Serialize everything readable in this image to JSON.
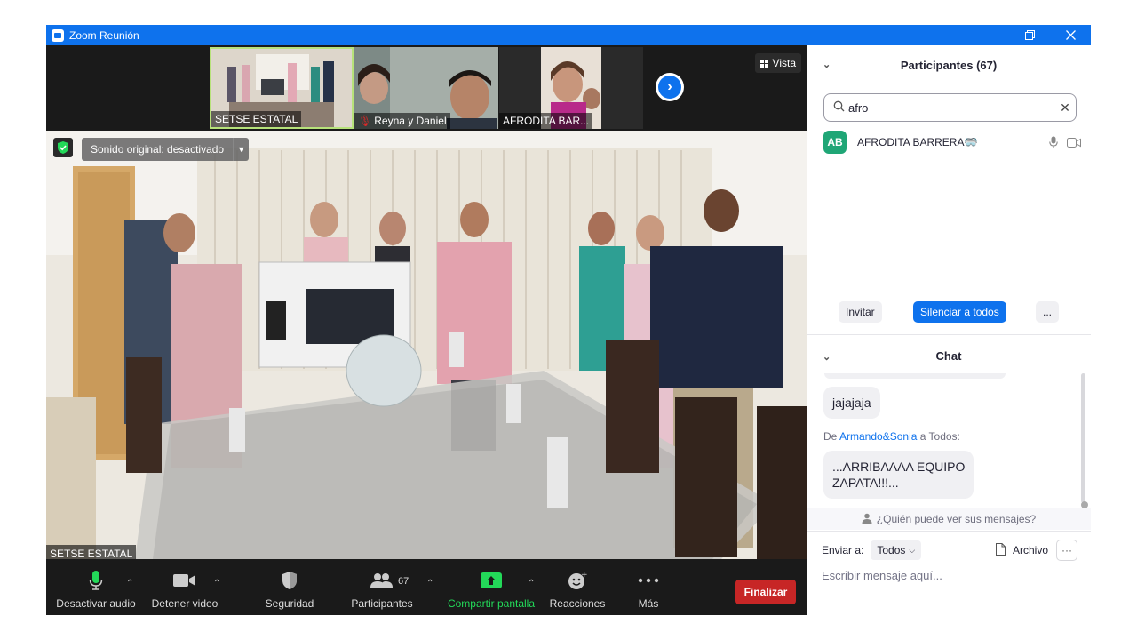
{
  "window": {
    "title": "Zoom Reunión"
  },
  "strip": {
    "thumbnails": [
      {
        "label": "SETSE ESTATAL",
        "muted": false
      },
      {
        "label": "Reyna y Daniel",
        "muted": true
      },
      {
        "label": "AFRODITA  BAR...",
        "muted": false
      }
    ],
    "view_label": "Vista"
  },
  "main_video": {
    "original_sound": "Sonido original: desactivado",
    "speaker_name": "SETSE ESTATAL"
  },
  "toolbar": {
    "mute_label": "Desactivar audio",
    "video_label": "Detener video",
    "security_label": "Seguridad",
    "participants_label": "Participantes",
    "participants_count": "67",
    "share_label": "Compartir pantalla",
    "reactions_label": "Reacciones",
    "more_label": "Más",
    "end_label": "Finalizar"
  },
  "participants_panel": {
    "title": "Participantes (67)",
    "search_value": "afro",
    "items": [
      {
        "initials": "AB",
        "name": "AFRODITA  BARRERA🥽",
        "avatar_color": "#1fa676"
      }
    ],
    "invite_label": "Invitar",
    "mute_all_label": "Silenciar a todos",
    "more_label": "..."
  },
  "chat": {
    "title": "Chat",
    "messages": [
      {
        "text": "jajajaja"
      },
      {
        "from_prefix": "De ",
        "sender": "Armando&Sonia",
        "to": " a Todos:",
        "text_line1": "...ARRIBAAAA EQUIPO",
        "text_line2": "ZAPATA!!!..."
      }
    ],
    "who_can_see": "¿Quién puede ver sus mensajes?",
    "send_to_label": "Enviar a:",
    "send_to_value": "Todos",
    "file_label": "Archivo",
    "more_label": "···",
    "input_placeholder": "Escribir mensaje aquí..."
  },
  "colors": {
    "accent": "#0e72ed",
    "end": "#c72626",
    "share": "#23d959",
    "avatar": "#1fa676"
  }
}
